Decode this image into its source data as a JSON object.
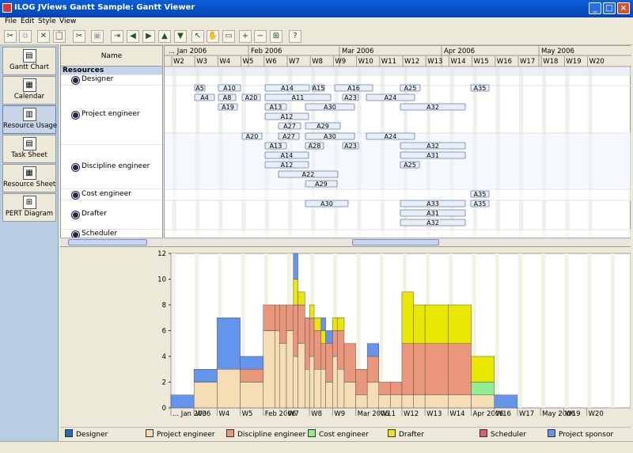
{
  "window": {
    "title": "ILOG JViews Gantt Sample: Gantt Viewer"
  },
  "menu": [
    "File",
    "Edit",
    "Style",
    "View"
  ],
  "toolbar": {
    "icons": [
      "cut-link-icon",
      "copy-link-icon",
      "delete-icon",
      "paste-icon",
      "cut-icon",
      "paste-disabled-icon",
      "indent-icon",
      "arrow-left-icon",
      "arrow-right-icon",
      "arrow-up-icon",
      "arrow-down-icon",
      "select-icon",
      "pan-icon",
      "marquee-icon",
      "zoom-in-icon",
      "zoom-out-icon",
      "zoom-fit-icon",
      "help-icon"
    ]
  },
  "sidebar": [
    {
      "label": "Gantt Chart",
      "icon": "gantt-chart-icon",
      "selected": false
    },
    {
      "label": "Calendar",
      "icon": "calendar-icon",
      "selected": false
    },
    {
      "label": "Resource Usage",
      "icon": "resource-usage-icon",
      "selected": true
    },
    {
      "label": "Task Sheet",
      "icon": "task-sheet-icon",
      "selected": false
    },
    {
      "label": "Resource Sheet",
      "icon": "resource-sheet-icon",
      "selected": false
    },
    {
      "label": "PERT Diagram",
      "icon": "pert-diagram-icon",
      "selected": false
    }
  ],
  "tree": {
    "header": "Name",
    "root": "Resources",
    "rows": [
      "Designer",
      "Project engineer",
      "Discipline engineer",
      "Cost engineer",
      "Drafter",
      "Scheduler"
    ]
  },
  "timeline": {
    "months": [
      "... Jan 2006",
      "Feb 2006",
      "Mar 2006",
      "Apr 2006",
      "May 2006"
    ],
    "weeks": [
      "W2",
      "W3",
      "W4",
      "W5",
      "W6",
      "W7",
      "W8",
      "W9",
      "W10",
      "W11",
      "W12",
      "W13",
      "W14",
      "W15",
      "W16",
      "W17",
      "W18",
      "W19",
      "W20"
    ]
  },
  "gantt_bars": [
    {
      "label": "A5",
      "row": "Designer"
    },
    {
      "label": "A10",
      "row": "Designer"
    },
    {
      "label": "A14",
      "row": "Designer"
    },
    {
      "label": "A15",
      "row": "Designer"
    },
    {
      "label": "A16",
      "row": "Designer"
    },
    {
      "label": "A25",
      "row": "Designer"
    },
    {
      "label": "A35",
      "row": "Designer"
    },
    {
      "label": "A4",
      "row": "Project engineer"
    },
    {
      "label": "A8",
      "row": "Project engineer"
    },
    {
      "label": "A20",
      "row": "Project engineer"
    },
    {
      "label": "A11",
      "row": "Project engineer"
    },
    {
      "label": "A23",
      "row": "Project engineer"
    },
    {
      "label": "A24",
      "row": "Project engineer"
    },
    {
      "label": "A19",
      "row": "Project engineer"
    },
    {
      "label": "A13",
      "row": "Project engineer"
    },
    {
      "label": "A30",
      "row": "Project engineer"
    },
    {
      "label": "A32",
      "row": "Project engineer"
    },
    {
      "label": "A12",
      "row": "Project engineer"
    },
    {
      "label": "A27",
      "row": "Project engineer"
    },
    {
      "label": "A29",
      "row": "Project engineer"
    },
    {
      "label": "A20",
      "row": "Discipline engineer"
    },
    {
      "label": "A27",
      "row": "Discipline engineer"
    },
    {
      "label": "A30",
      "row": "Discipline engineer"
    },
    {
      "label": "A24",
      "row": "Discipline engineer"
    },
    {
      "label": "A13",
      "row": "Discipline engineer"
    },
    {
      "label": "A28",
      "row": "Discipline engineer"
    },
    {
      "label": "A23",
      "row": "Discipline engineer"
    },
    {
      "label": "A32",
      "row": "Discipline engineer"
    },
    {
      "label": "A14",
      "row": "Discipline engineer"
    },
    {
      "label": "A31",
      "row": "Discipline engineer"
    },
    {
      "label": "A12",
      "row": "Discipline engineer"
    },
    {
      "label": "A25",
      "row": "Discipline engineer"
    },
    {
      "label": "A22",
      "row": "Discipline engineer"
    },
    {
      "label": "A29",
      "row": "Discipline engineer"
    },
    {
      "label": "A35",
      "row": "Cost engineer"
    },
    {
      "label": "A30",
      "row": "Drafter"
    },
    {
      "label": "A33",
      "row": "Drafter"
    },
    {
      "label": "A35",
      "row": "Drafter"
    },
    {
      "label": "A31",
      "row": "Drafter"
    },
    {
      "label": "A32",
      "row": "Drafter"
    }
  ],
  "colors": {
    "Designer": "#1f6db8",
    "Project engineer": "#f5deb3",
    "Discipline engineer": "#e9967a",
    "Cost engineer": "#90ee90",
    "Drafter": "#e8e800",
    "Scheduler": "#dc5a78",
    "Project sponsor": "#6495ed"
  },
  "chart_data": {
    "type": "area",
    "stacked": true,
    "ylim": [
      0,
      12
    ],
    "yticks": [
      0,
      2,
      4,
      6,
      8,
      10,
      12
    ],
    "xticks": [
      "... Jan 2006",
      "W3",
      "W4",
      "W5",
      "Feb 2006",
      "W7",
      "W8",
      "W9",
      "Mar 2006",
      "W11",
      "W12",
      "W13",
      "W14",
      "Apr 2006",
      "W16",
      "W17",
      "May 2006",
      "W19",
      "W20"
    ],
    "x_unit": "week",
    "x_start": "W2",
    "x": [
      2.0,
      3.0,
      4.0,
      5.0,
      6.0,
      6.5,
      6.7,
      7.0,
      7.3,
      7.5,
      7.8,
      8.0,
      8.2,
      8.5,
      8.7,
      9.0,
      9.2,
      9.5,
      10.0,
      10.5,
      11.0,
      11.5,
      12.0,
      12.5,
      13.0,
      14.0,
      15.0,
      16.0,
      17.0
    ],
    "series": [
      {
        "name": "Project engineer",
        "values": [
          0,
          2,
          3,
          2,
          6,
          6,
          5,
          6,
          4,
          5,
          3,
          4,
          3,
          3,
          2,
          4,
          3,
          2,
          1,
          2,
          1,
          1,
          1,
          1,
          1,
          1,
          1,
          0,
          0
        ]
      },
      {
        "name": "Discipline engineer",
        "values": [
          0,
          0,
          0,
          1,
          2,
          2,
          3,
          2,
          4,
          3,
          4,
          3,
          3,
          2,
          3,
          2,
          3,
          3,
          2,
          2,
          1,
          1,
          4,
          4,
          4,
          4,
          0,
          0,
          0
        ]
      },
      {
        "name": "Cost engineer",
        "values": [
          0,
          0,
          0,
          0,
          0,
          0,
          0,
          0,
          0,
          0,
          0,
          0,
          0,
          0,
          0,
          0,
          0,
          0,
          0,
          0,
          0,
          0,
          0,
          0,
          0,
          0,
          1,
          0,
          0
        ]
      },
      {
        "name": "Drafter",
        "values": [
          0,
          0,
          0,
          0,
          0,
          0,
          0,
          0,
          2,
          1,
          0,
          1,
          1,
          1,
          0,
          1,
          1,
          0,
          0,
          0,
          0,
          0,
          4,
          3,
          3,
          3,
          2,
          0,
          0
        ]
      },
      {
        "name": "Project sponsor",
        "values": [
          1,
          1,
          4,
          1,
          0,
          0,
          0,
          0,
          2,
          0,
          0,
          0,
          0,
          1,
          1,
          0,
          0,
          0,
          0,
          1,
          0,
          0,
          0,
          0,
          0,
          0,
          0,
          1,
          0
        ]
      }
    ]
  },
  "legend": [
    "Designer",
    "Project engineer",
    "Discipline engineer",
    "Cost engineer",
    "Drafter",
    "Scheduler",
    "Project sponsor"
  ]
}
